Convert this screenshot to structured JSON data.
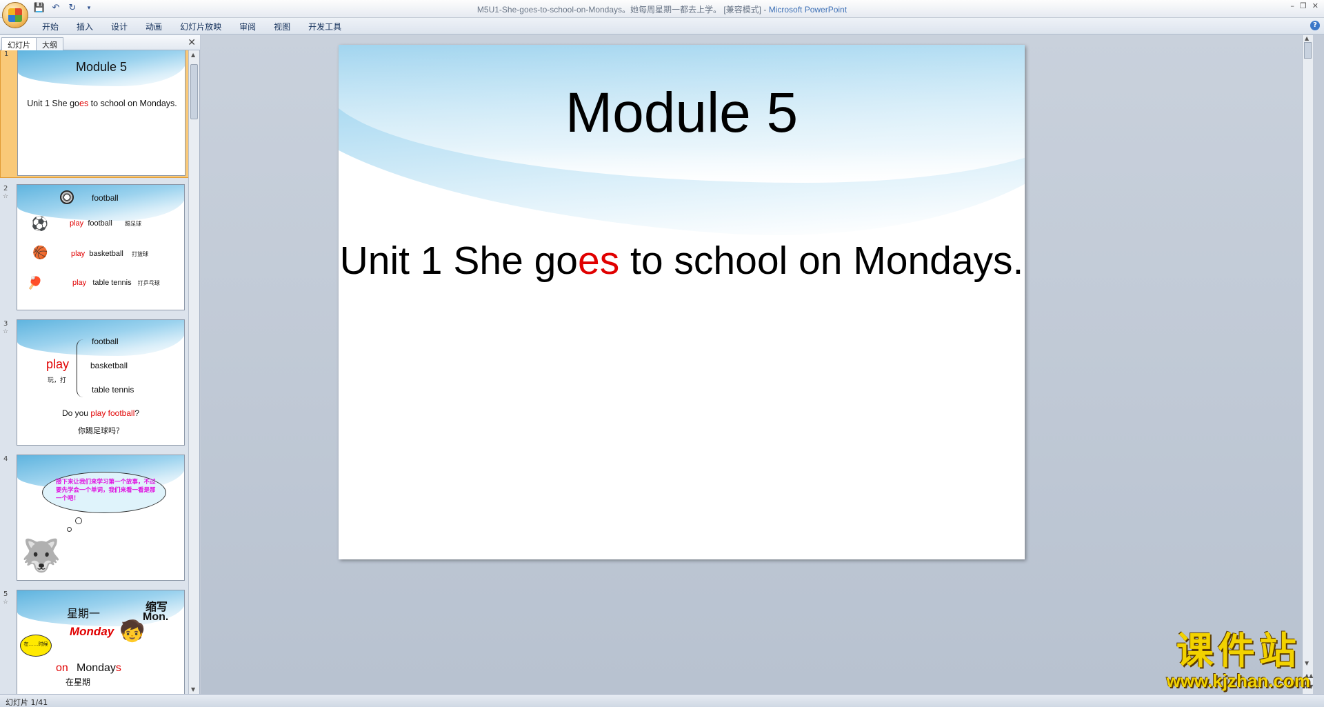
{
  "window": {
    "title_doc": "M5U1-She-goes-to-school-on-Mondays。她每周星期一都去上学。 [兼容模式] - ",
    "title_app": "Microsoft PowerPoint"
  },
  "ribbon": {
    "tabs": [
      "开始",
      "插入",
      "设计",
      "动画",
      "幻灯片放映",
      "审阅",
      "视图",
      "开发工具"
    ]
  },
  "pane": {
    "tab_slides": "幻灯片",
    "tab_outline": "大纲"
  },
  "thumbnails": {
    "s1": {
      "num": "1",
      "title": "Module 5",
      "sub_a": "Unit 1  She go",
      "sub_red": "es",
      "sub_b": " to school on Mondays."
    },
    "s2": {
      "num": "2",
      "header": "football",
      "rows": [
        {
          "verb": "play",
          "obj": "football",
          "cn": "踢足球"
        },
        {
          "verb": "play",
          "obj": "basketball",
          "cn": "打篮球"
        },
        {
          "verb": "play",
          "obj": "table tennis",
          "cn": "打乒乓球"
        }
      ]
    },
    "s3": {
      "num": "3",
      "verb": "play",
      "verb_cn": "玩，打",
      "items": [
        "football",
        "basketball",
        "table tennis"
      ],
      "q_a": "Do you ",
      "q_red": "play football",
      "q_b": "?",
      "q_cn": "你踢足球吗？"
    },
    "s4": {
      "num": "4",
      "bubble": "接下来让我们来学习第一个故事，不过要先学会一个单词，我们来看一看是那一个吧！"
    },
    "s5": {
      "num": "5",
      "day_cn": "星期一",
      "abbr_label": "缩写",
      "abbr": "Mon.",
      "word": "Monday",
      "on": "on",
      "mondays_a": "Monday",
      "mondays_s": "s",
      "bubble_small": "在……时候",
      "cut": "在星期"
    }
  },
  "slide": {
    "title": "Module 5",
    "sub_a": "Unit 1 She go",
    "sub_red": "es",
    "sub_b": " to school on Mondays."
  },
  "status": {
    "slide_counter": "幻灯片 1/41"
  },
  "watermark": {
    "big": "课件站",
    "url": "www.kjzhan.com"
  },
  "colors": {
    "accent_red": "#e00000",
    "selection": "#f9c978",
    "watermark": "#f2d200"
  }
}
